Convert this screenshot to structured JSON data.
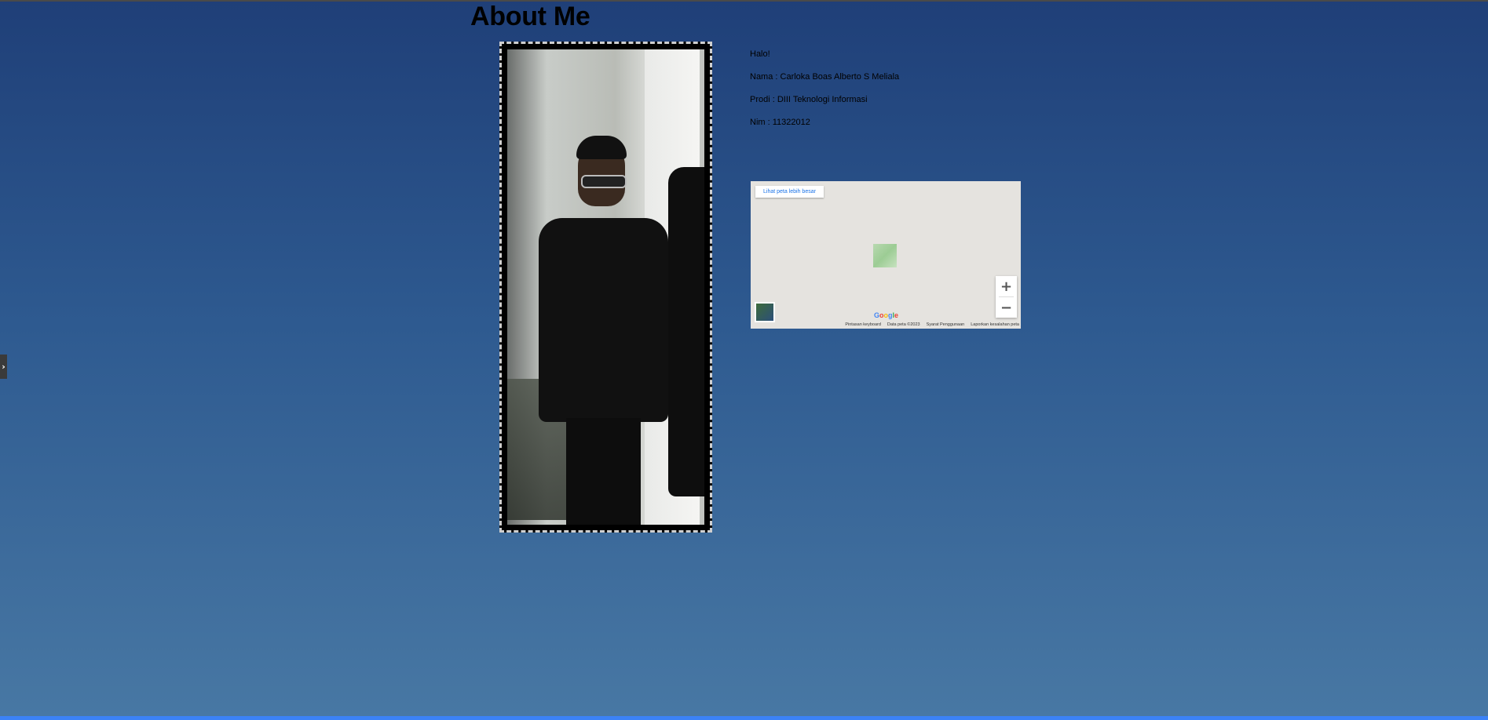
{
  "page": {
    "title": "About Me",
    "side_toggle": "›"
  },
  "profile": {
    "greeting": "Halo!",
    "name": "Nama : Carloka Boas Alberto S Meliala",
    "prodi": "Prodi : DIII Teknologi Informasi",
    "nim": "Nim : 11322012"
  },
  "map": {
    "larger_map_link": "Lihat peta lebih besar",
    "zoom_in": "+",
    "zoom_out": "−",
    "logo": "Google",
    "attribution": {
      "shortcuts": "Pintasan keyboard",
      "map_data": "Data peta ©2023",
      "terms": "Syarat Penggunaan",
      "report": "Laporkan kesalahan peta"
    }
  },
  "colors": {
    "background_top": "#1f3f78",
    "background_bottom": "#4878a4",
    "accent_bottom_bar": "#3b82f6",
    "map_link": "#1a73e8"
  }
}
